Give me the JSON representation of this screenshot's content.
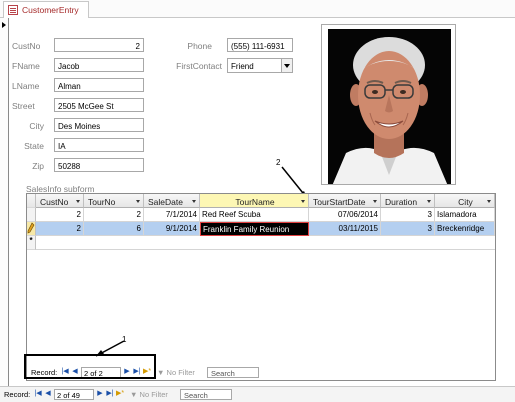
{
  "tab": {
    "title": "CustomerEntry"
  },
  "form": {
    "fields": [
      {
        "label": "CustNo",
        "value": "2"
      },
      {
        "label": "FName",
        "value": "Jacob"
      },
      {
        "label": "LName",
        "value": "Alman"
      },
      {
        "label": "Street",
        "value": "2505 McGee St"
      },
      {
        "label": "City",
        "value": "Des Moines"
      },
      {
        "label": "State",
        "value": "IA"
      },
      {
        "label": "Zip",
        "value": "50288"
      }
    ],
    "phone": {
      "label": "Phone",
      "value": "(555) 111-6931"
    },
    "first_contact": {
      "label": "FirstContact",
      "value": "Friend"
    }
  },
  "subform": {
    "label": "SalesInfo subform",
    "columns": [
      "CustNo",
      "TourNo",
      "SaleDate",
      "TourName",
      "TourStartDate",
      "Duration",
      "City"
    ],
    "rows": [
      [
        "2",
        "2",
        "7/1/2014",
        "Red Reef Scuba",
        "07/06/2014",
        "3",
        "Islamadora"
      ],
      [
        "2",
        "6",
        "9/1/2014",
        "Franklin Family Reunion",
        "03/11/2015",
        "3",
        "Breckenridge"
      ]
    ],
    "new_row_marker": "*",
    "nav": {
      "label": "Record:",
      "position": "2 of 2",
      "filter": "No Filter",
      "search": "Search"
    }
  },
  "main_nav": {
    "label": "Record:",
    "position": "2 of 49",
    "filter": "No Filter",
    "search": "Search"
  },
  "annotations": {
    "one": "1",
    "two": "2"
  },
  "colors": {
    "selected_row": "#b4cff0",
    "active_header": "#fdf7b4",
    "tab_text": "#a52a2a"
  }
}
